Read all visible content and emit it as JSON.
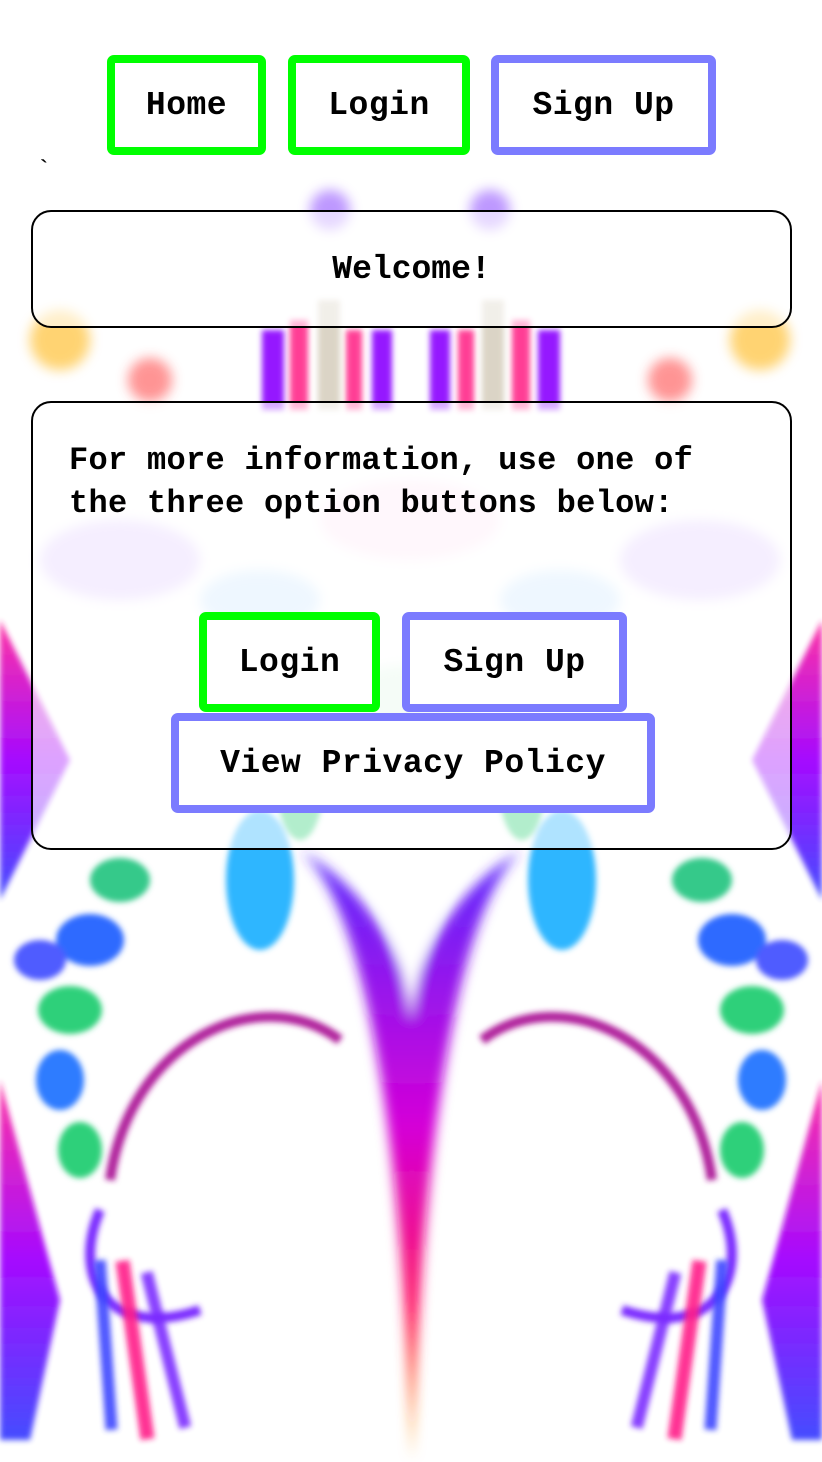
{
  "nav": {
    "home_label": "Home",
    "login_label": "Login",
    "signup_label": "Sign Up"
  },
  "stray_mark": "`",
  "welcome": {
    "text": "Welcome!"
  },
  "info": {
    "text": "For more information, use one of the three option buttons below:",
    "login_label": "Login",
    "signup_label": "Sign Up",
    "privacy_label": "View Privacy Policy"
  },
  "colors": {
    "primary_button_border": "#00ff00",
    "secondary_button_border": "#7b7bff",
    "card_border": "#000000"
  },
  "background": {
    "description_icon": "psychedelic-fractal-background"
  }
}
